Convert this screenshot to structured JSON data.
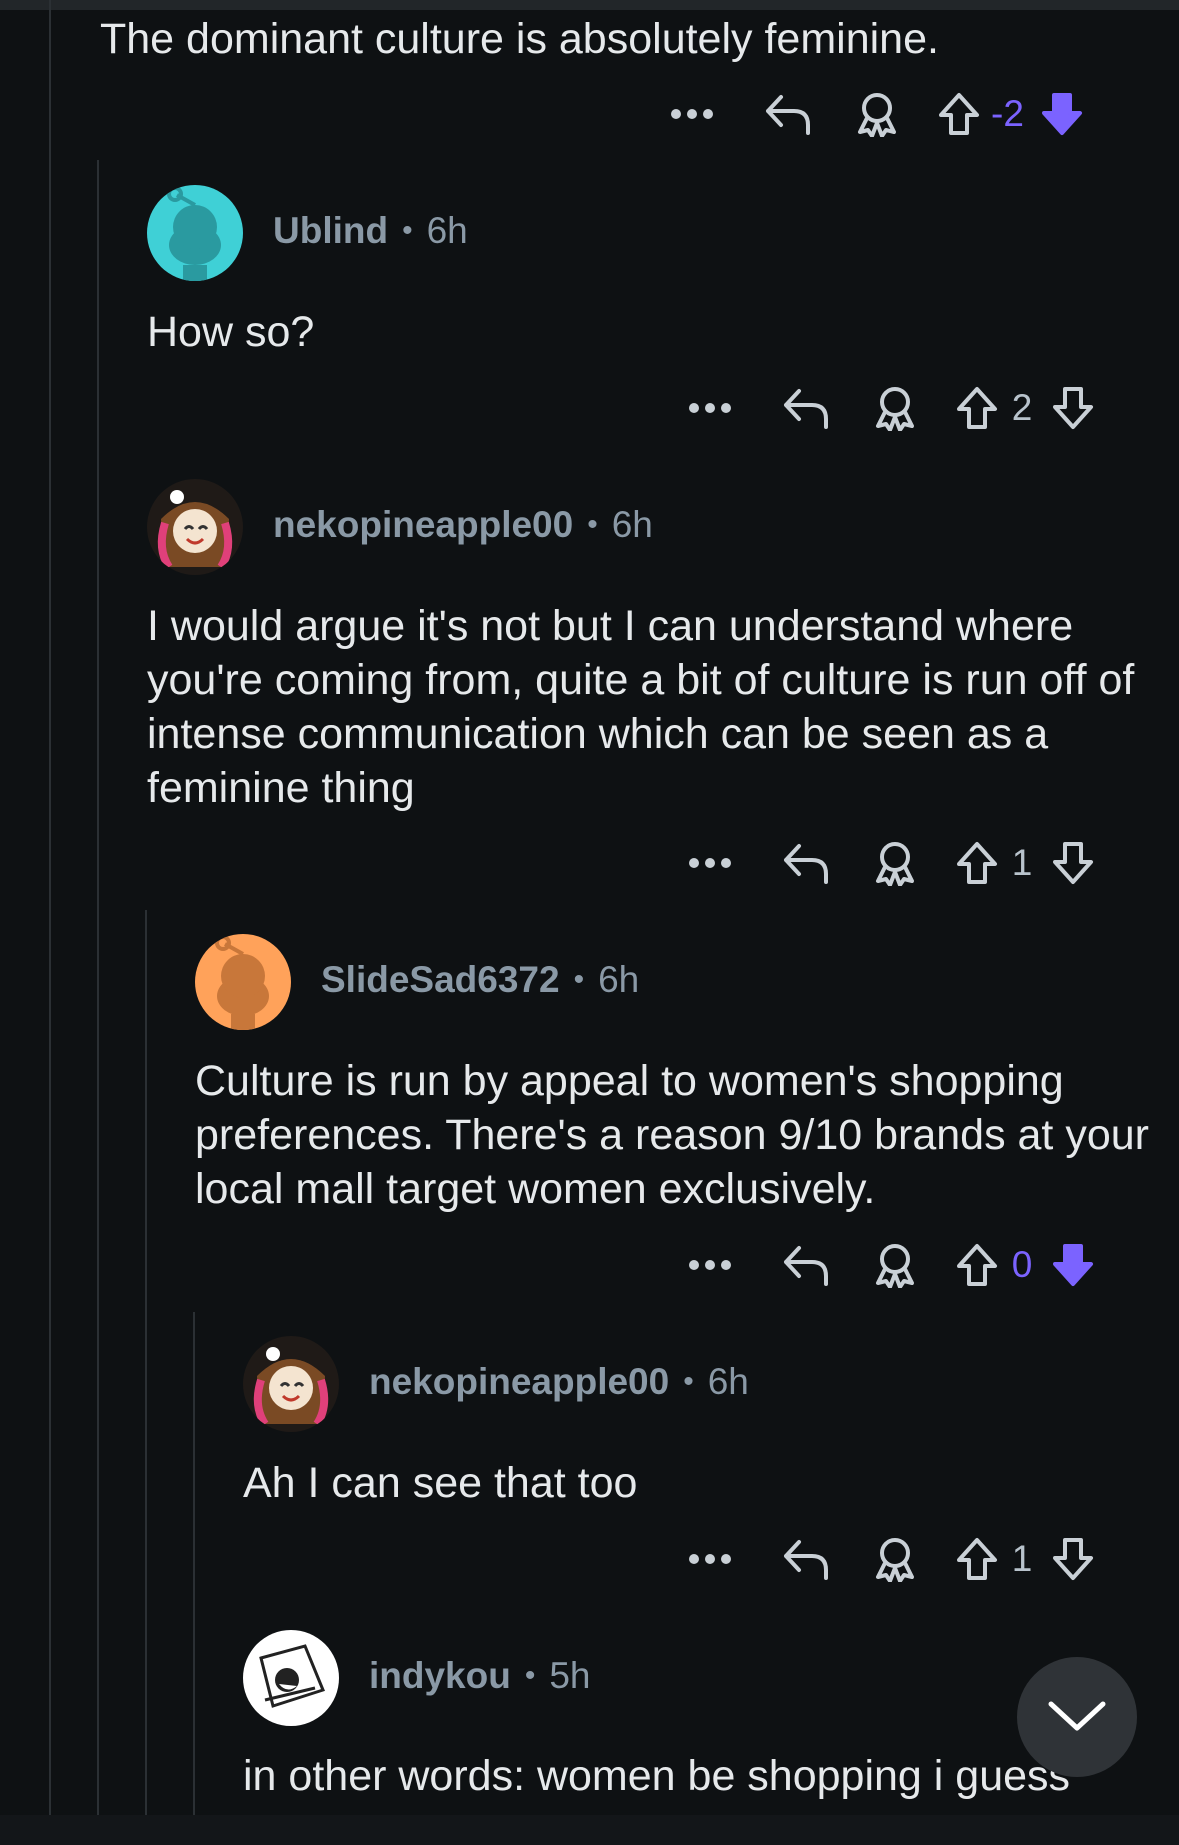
{
  "comments": [
    {
      "username": "",
      "time": "",
      "text": "The dominant culture is absolutely feminine.",
      "score": "-2",
      "vote": "down"
    },
    {
      "username": "Ublind",
      "time": "6h",
      "text": "How so?",
      "score": "2",
      "vote": "none"
    },
    {
      "username": "nekopineapple00",
      "time": "6h",
      "text": "I would argue it's not but I can understand where you're coming from, quite a bit of culture is run off of intense communication which can be seen as a feminine thing",
      "score": "1",
      "vote": "none"
    },
    {
      "username": "SlideSad6372",
      "time": "6h",
      "text": "Culture is run by appeal to women's shopping preferences. There's a reason 9/10 brands at your local mall target women exclusively.",
      "score": "0",
      "vote": "down"
    },
    {
      "username": "nekopineapple00",
      "time": "6h",
      "text": "Ah I can see that too",
      "score": "1",
      "vote": "none"
    },
    {
      "username": "indykou",
      "time": "5h",
      "text": "in other words: women be shopping i guess",
      "score": "",
      "vote": "none"
    }
  ],
  "separator": "•",
  "colors": {
    "background": "#0e1113",
    "downvote_active": "#7b63ff",
    "username": "#8a99a6",
    "snoo_teal": "#3fd0d6",
    "snoo_orange": "#ffa25a"
  },
  "icons": [
    "more-icon",
    "reply-icon",
    "award-icon",
    "upvote-icon",
    "downvote-icon",
    "chevron-down-icon"
  ]
}
